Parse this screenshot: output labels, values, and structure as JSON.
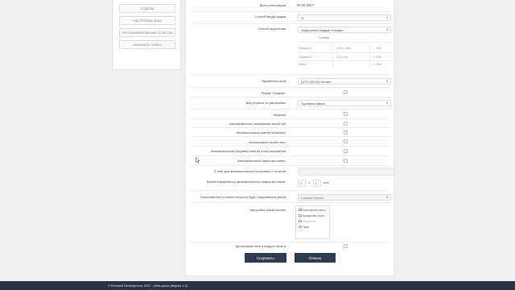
{
  "sidebar": {
    "items": [
      {
        "label": "ОТДЕЛЫ"
      },
      {
        "label": "НАСТРОЙКИ ЧЕКА"
      },
      {
        "label": "ПРОГРАММИРОВАНИЕ ОТЧЕТОВ"
      },
      {
        "label": "ИЗМЕНИТЬ ТОКЕН"
      }
    ]
  },
  "form": {
    "reg_date_label": "Дата регистрации",
    "reg_date_value": "25.04.2017",
    "discount_method_label": "Способ ввода скидки",
    "discount_method_value": "%",
    "rounding_label": "Способ округления",
    "rounding_value": "Округление каждой позиции",
    "example": {
      "header": "Пример",
      "rows": [
        {
          "name": "Позиция 1",
          "calc": "1,55 x 10т",
          "sum": "= 16т"
        },
        {
          "name": "Позиция 2",
          "calc": "2,4 x 7т",
          "sum": "= 17т"
        },
        {
          "name": "Итог",
          "calc": "",
          "sum": "= 33т"
        }
      ]
    },
    "timezone_label": "Временная зона",
    "timezone_value": "(UTC+06:00) Астана",
    "purchase_mode_label": "Режим \"Покупка\"",
    "business_type_label": "Вид отрасли по умолчанию",
    "business_type_value": "Торговая сфера",
    "markup_label": "Наценка",
    "auto_pdf_label": "Автоматическое скачивание чека в pdf",
    "auto_cash_label": "Автоматическое взятие наличные",
    "price_list_label": "Использовать прайс лист",
    "auto_email_label": "Автоматическая отправка чека на email покупателя",
    "auto_close_label": "Автоматическое закрытие смены",
    "z_email_label": "E-mail для автоматического получения Z-отчетов",
    "daily_close_time_label": "Время ежедневного автоматического закрытия смены",
    "hours_value": "0",
    "hours_unit": "ч",
    "minutes_value": "0",
    "minutes_unit": "мин",
    "shift_user_label": "Пользователь от имени которого будет закрываться смена",
    "shift_user_value": "Сумкин Платон",
    "payment_types_label": "Настройка типов оплаты",
    "payment_types": [
      {
        "label": "Банковская карта",
        "checked": true
      },
      {
        "label": "Кредитная карта",
        "checked": false
      },
      {
        "label": "Наличные",
        "checked": true
      },
      {
        "label": "Тара",
        "checked": false
      }
    ],
    "offline_label": "Автономные чеки в модуле печати",
    "save_label": "Сохранить",
    "cancel_label": "Отмена"
  },
  "footer": {
    "text": "© Everyshi Development, 2017 - Web-касса (версия 1.0)"
  },
  "colors": {
    "button_bg": "#2e3b4e",
    "footer_bg": "#2a3344",
    "page_bg": "#f0f0f0"
  }
}
